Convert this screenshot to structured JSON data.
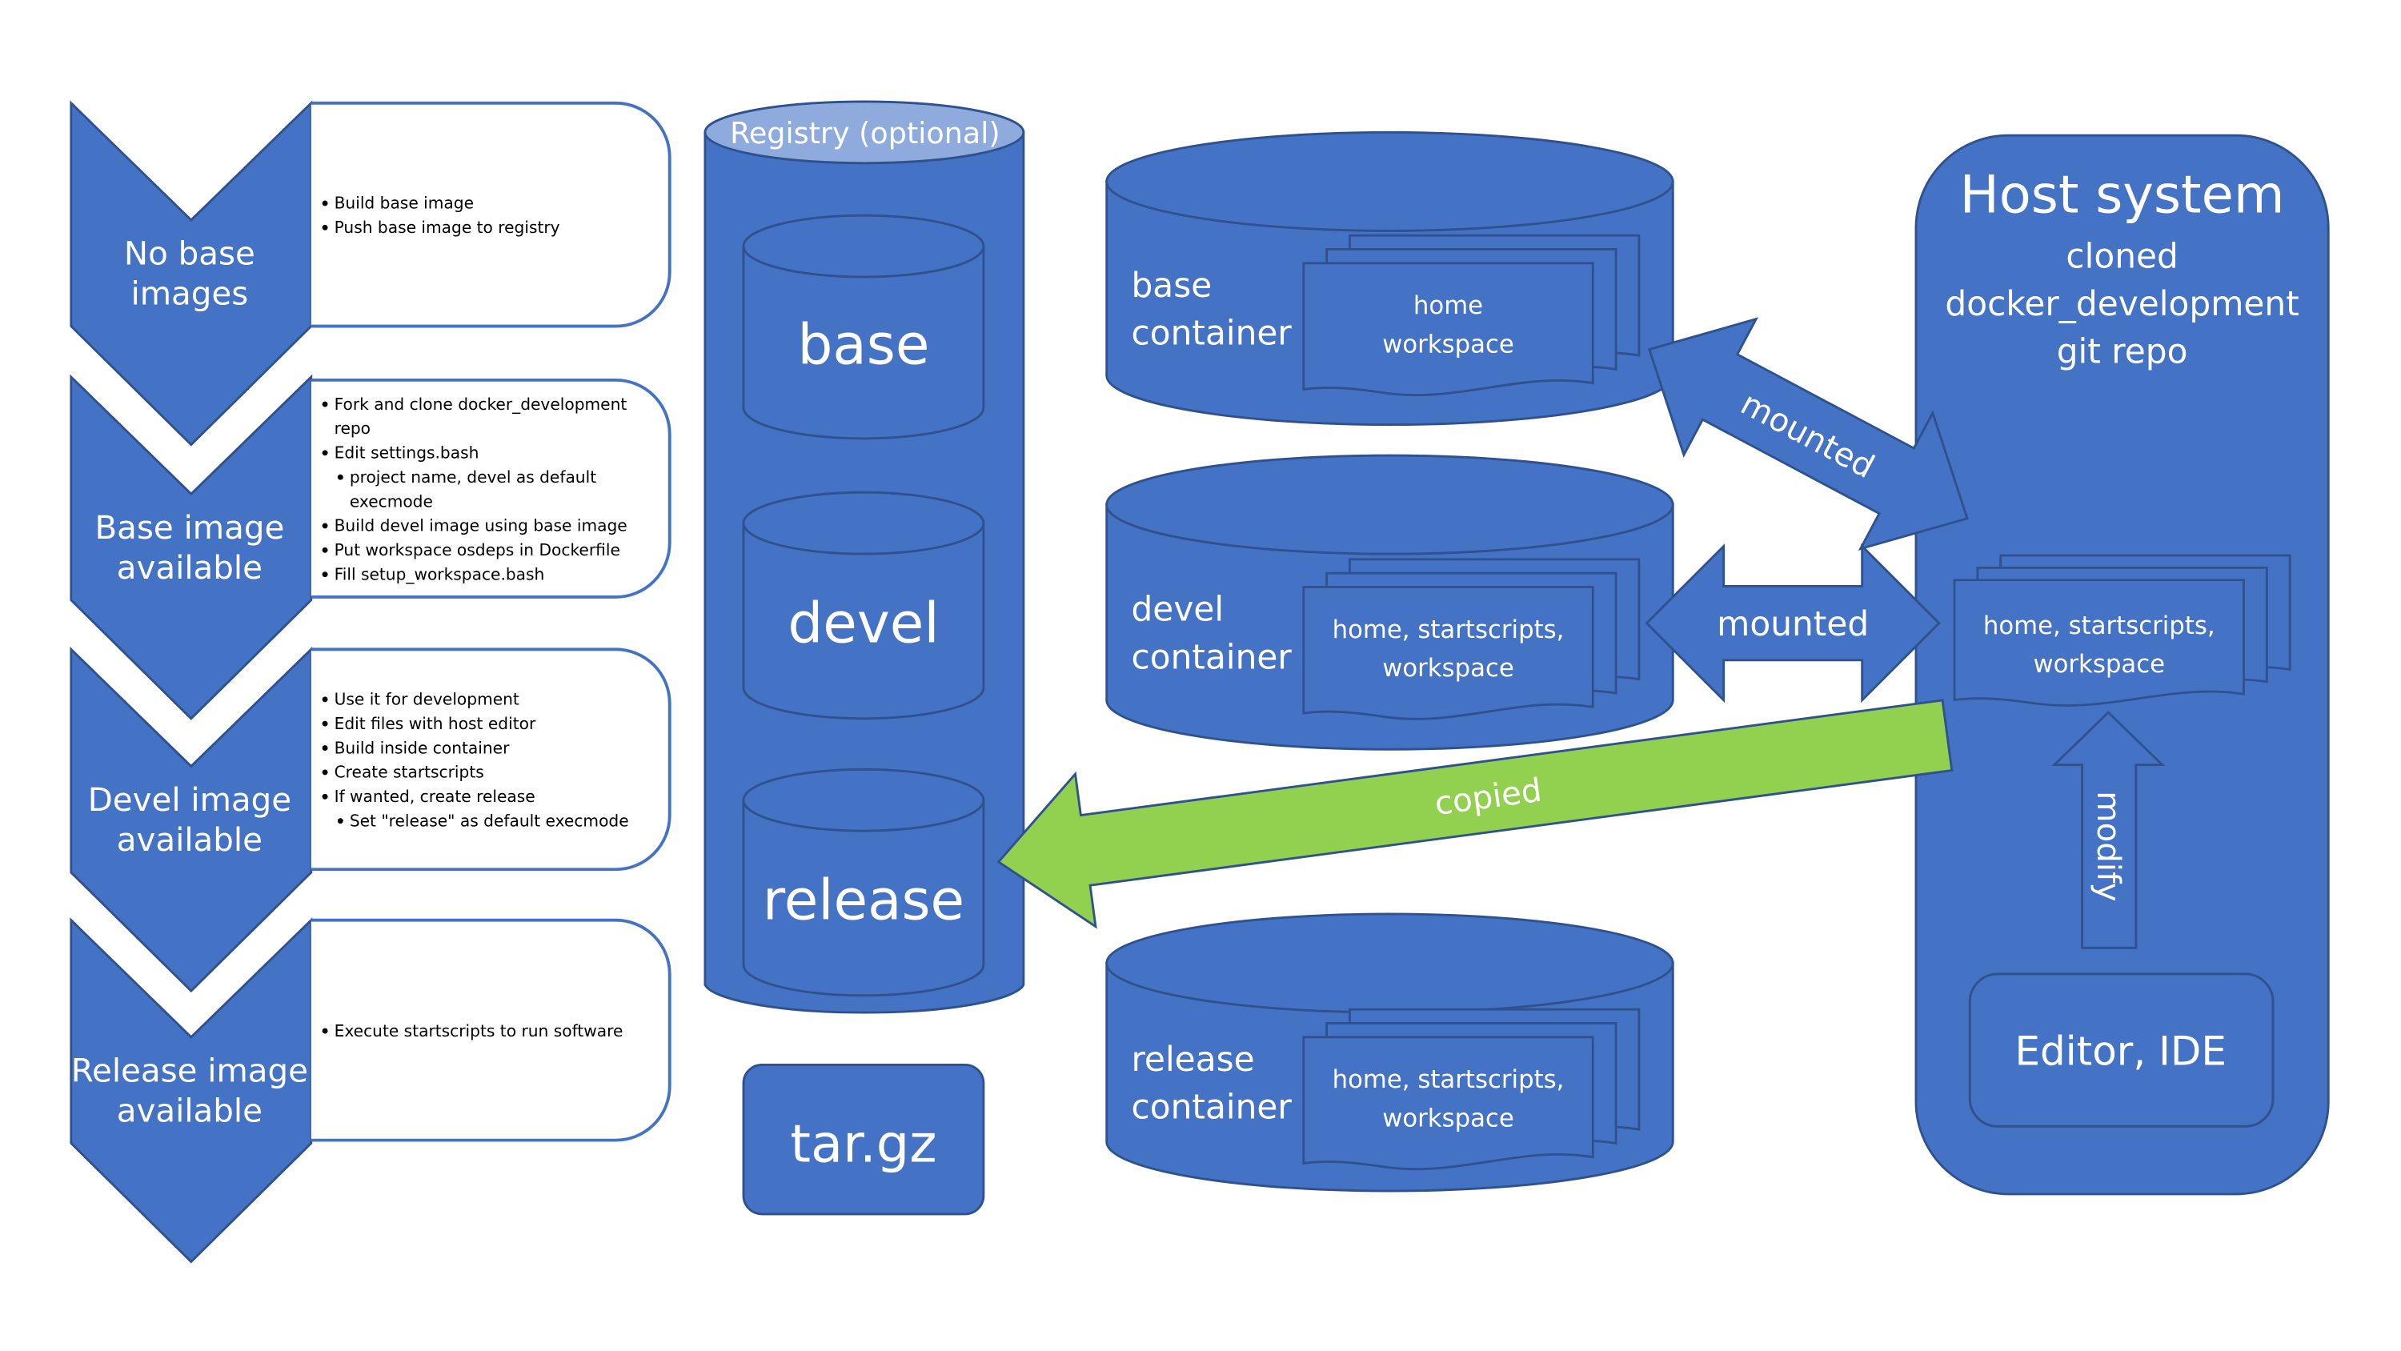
{
  "colors": {
    "primary": "#4472C4",
    "outline": "#2F528F",
    "registry_top": "#8FAADC",
    "copied_arrow": "#92D050",
    "background": "#FFFFFF"
  },
  "stages": [
    {
      "label": [
        "No base",
        "images"
      ],
      "notes": [
        {
          "text": "Build base image",
          "level": 1
        },
        {
          "text": "Push base image to registry",
          "level": 1
        }
      ]
    },
    {
      "label": [
        "Base image",
        "available"
      ],
      "notes": [
        {
          "text": "Fork and clone docker_development",
          "level": 1
        },
        {
          "text": "repo",
          "level": 1,
          "continuation": true
        },
        {
          "text": "Edit settings.bash",
          "level": 1
        },
        {
          "text": "project name, devel as default",
          "level": 2
        },
        {
          "text": "execmode",
          "level": 2,
          "continuation": true
        },
        {
          "text": "Build devel image using base image",
          "level": 1
        },
        {
          "text": "Put workspace osdeps in Dockerfile",
          "level": 1
        },
        {
          "text": "Fill setup_workspace.bash",
          "level": 1
        }
      ]
    },
    {
      "label": [
        "Devel image",
        "available"
      ],
      "notes": [
        {
          "text": "Use it for development",
          "level": 1
        },
        {
          "text": "Edit files with host editor",
          "level": 1
        },
        {
          "text": "Build inside container",
          "level": 1
        },
        {
          "text": "Create startscripts",
          "level": 1
        },
        {
          "text": "If wanted, create release",
          "level": 1
        },
        {
          "text": "Set \"release\" as default execmode",
          "level": 2
        }
      ]
    },
    {
      "label": [
        "Release image",
        "available"
      ],
      "notes": [
        {
          "text": "Execute startscripts to run software",
          "level": 1
        }
      ]
    }
  ],
  "registry": {
    "title": "Registry (optional)",
    "images": [
      "base",
      "devel",
      "release"
    ],
    "archive": "tar.gz"
  },
  "containers": [
    {
      "label": [
        "base",
        "container"
      ],
      "contents": [
        "home",
        "workspace"
      ]
    },
    {
      "label": [
        "devel",
        "container"
      ],
      "contents": [
        "home, startscripts,",
        "workspace"
      ]
    },
    {
      "label": [
        "release",
        "container"
      ],
      "contents": [
        "home, startscripts,",
        "workspace"
      ]
    }
  ],
  "arrows": {
    "base_mount": "mounted",
    "devel_mount": "mounted",
    "copy": "copied",
    "modify": "modify"
  },
  "host": {
    "title": "Host system",
    "subtitle": [
      "cloned",
      "docker_development",
      "git repo"
    ],
    "contents": [
      "home, startscripts,",
      "workspace"
    ],
    "editor": "Editor, IDE"
  }
}
